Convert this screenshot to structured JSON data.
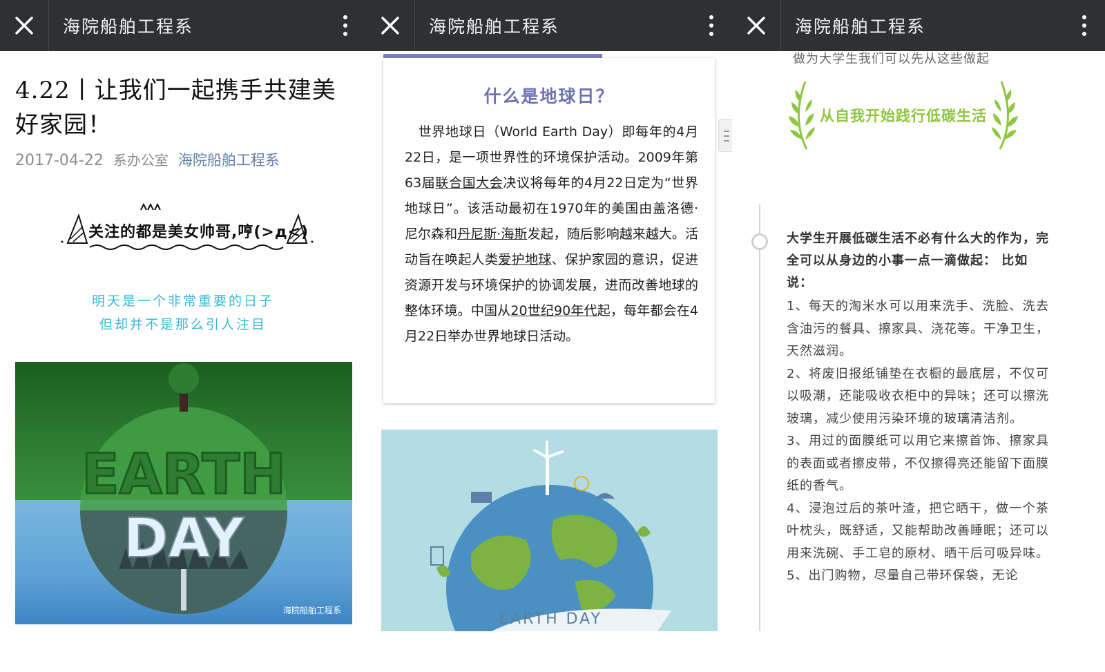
{
  "panels": [
    {
      "header": {
        "title": "海院船舶工程系",
        "close_icon": "close-icon",
        "menu_icon": "more-vertical-icon"
      }
    },
    {
      "header": {
        "title": "海院船舶工程系",
        "close_icon": "close-icon",
        "menu_icon": "more-vertical-icon"
      }
    },
    {
      "header": {
        "title": "海院船舶工程系",
        "close_icon": "close-icon",
        "menu_icon": "more-vertical-icon"
      }
    }
  ],
  "article": {
    "title": "4.22丨让我们一起携手共建美好家园！",
    "date": "2017-04-22",
    "author": "系办公室",
    "account": "海院船舶工程系",
    "banner_text": "关注的都是美女帅哥,哼(>д<)",
    "intro_line1": "明天是一个非常重要的日子",
    "intro_line2": "但却并不是那么引人注目",
    "image1_watermark": "海院船舶工程系"
  },
  "card": {
    "title": "什么是地球日？",
    "p_1": "世界地球日（World Earth Day）即每年的4月22日，是一项世界性的环境保护活动。2009年第63届",
    "link_un": "联合国大会",
    "p_2": "决议将每年的4月22日定为“世界地球日”。该活动最初在1970年的美国由",
    "link_gaylord": "盖洛德·尼尔森",
    "p_3": "和",
    "link_hayes": "丹尼斯·海斯",
    "p_4": "发起，随后影响越来越大。活动旨在唤起人类",
    "link_protect": "爱护地球",
    "p_5": "、保护家园的意识，促进资源开发与环境保护的协调发展，进而改善地球的整体环境。中国从",
    "link_90s": "20世纪90年代",
    "p_6": "起，每年都会在4月22日举办世界地球日活动。"
  },
  "image2": {
    "label": "EARTH DAY"
  },
  "tips": {
    "intro": "做为大学生我们可以先从这些做起",
    "banner": "从自我开始践行低碳生活",
    "lead": "大学生开展低碳生活不必有什么大的作为，完全可以从身边的小事一点一滴做起： 比如说：",
    "item1": "1、每天的淘米水可以用来洗手、洗脸、洗去含油污的餐具、擦家具、浇花等。干净卫生，天然滋润。",
    "item2": "2、将废旧报纸铺垫在衣橱的最底层，不仅可以吸潮，还能吸收衣柜中的异味；还可以擦洗玻璃，减少使用污染环境的玻璃清洁剂。",
    "item3": "3、用过的面膜纸可以用它来擦首饰、擦家具的表面或者擦皮带，不仅擦得亮还能留下面膜纸的香气。",
    "item4": "4、浸泡过后的茶叶渣，把它晒干，做一个茶叶枕头，既舒适，又能帮助改善睡眠；还可以用来洗碗、手工皂的原材、晒干后可吸异味。",
    "item5": "5、出门购物，尽量自己带环保袋，无论"
  },
  "colors": {
    "topbar": "#2e3133",
    "account_link": "#607fa6",
    "cyan": "#3ab7d4",
    "card_accent": "#6d73b3",
    "laurel_green": "#8dc63f"
  }
}
